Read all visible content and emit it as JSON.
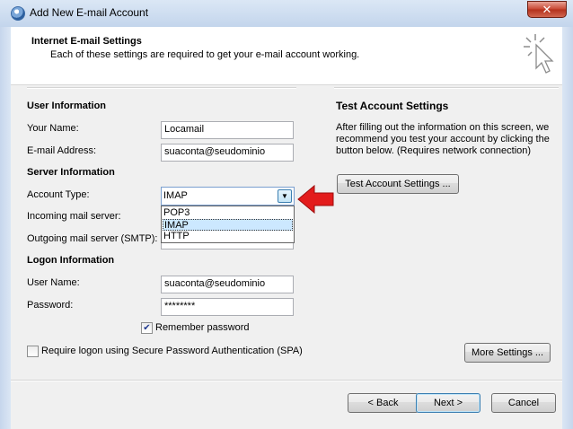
{
  "window": {
    "title": "Add New E-mail Account",
    "close_label": "✕"
  },
  "header": {
    "title": "Internet E-mail Settings",
    "subtitle": "Each of these settings are required to get your e-mail account working."
  },
  "user_info": {
    "section_label": "User Information",
    "name_label": "Your Name:",
    "name_value": "Locamail",
    "email_label": "E-mail Address:",
    "email_value": "suaconta@seudominio"
  },
  "server_info": {
    "section_label": "Server Information",
    "account_type_label": "Account Type:",
    "account_type_value": "IMAP",
    "account_type_options": [
      "POP3",
      "IMAP",
      "HTTP"
    ],
    "incoming_label": "Incoming mail server:",
    "outgoing_label": "Outgoing mail server (SMTP):"
  },
  "logon_info": {
    "section_label": "Logon Information",
    "username_label": "User Name:",
    "username_value": "suaconta@seudominio",
    "password_label": "Password:",
    "password_value": "********",
    "remember_label": "Remember password",
    "remember_checked": true,
    "spa_label": "Require logon using Secure Password Authentication (SPA)",
    "spa_checked": false
  },
  "test_settings": {
    "section_label": "Test Account Settings",
    "description": "After filling out the information on this screen, we recommend you test your account by clicking the button below. (Requires network connection)",
    "button_label": "Test Account Settings ..."
  },
  "footer": {
    "more_settings_label": "More Settings ...",
    "back_label": "< Back",
    "next_label": "Next >",
    "cancel_label": "Cancel"
  },
  "colors": {
    "annotation_arrow": "#e31c1c",
    "selection_highlight": "#cce8ff"
  }
}
